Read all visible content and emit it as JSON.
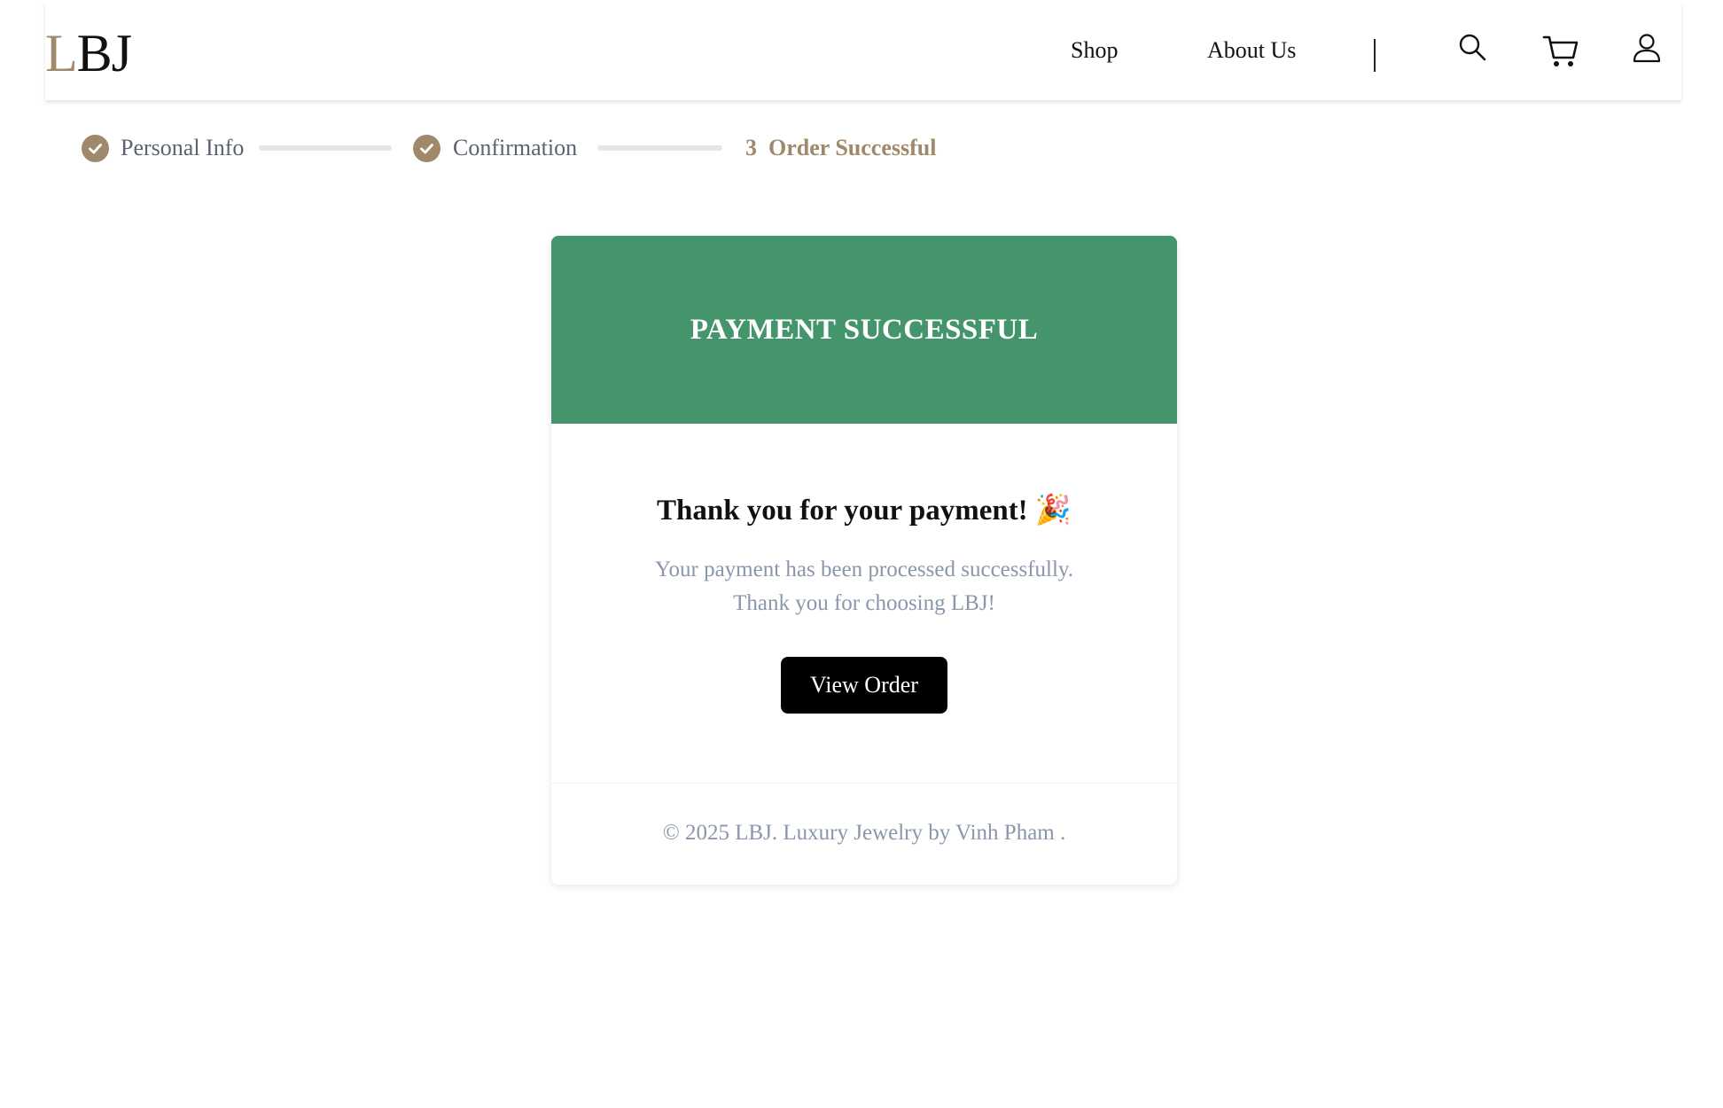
{
  "header": {
    "logo_first": "L",
    "logo_rest": "BJ",
    "nav": {
      "shop": "Shop",
      "about": "About Us"
    },
    "icons": [
      "search-icon",
      "cart-icon",
      "user-icon"
    ]
  },
  "stepper": {
    "step1": {
      "label": "Personal Info",
      "status": "completed"
    },
    "step2": {
      "label": "Confirmation",
      "status": "completed"
    },
    "step3": {
      "number": "3",
      "label": "Order Successful",
      "status": "active"
    }
  },
  "card": {
    "banner_title": "PAYMENT SUCCESSFUL",
    "heading": "Thank you for your payment!",
    "heading_emoji": "🎉",
    "message_line1": "Your payment has been processed successfully.",
    "message_line2": "Thank you for choosing LBJ!",
    "button_label": "View Order",
    "footer": "© 2025 LBJ. Luxury Jewelry by Vinh Pham ."
  },
  "colors": {
    "accent": "#a0896a",
    "success_green": "#44956c",
    "muted_text": "#8a96ab",
    "button_bg": "#000000"
  }
}
